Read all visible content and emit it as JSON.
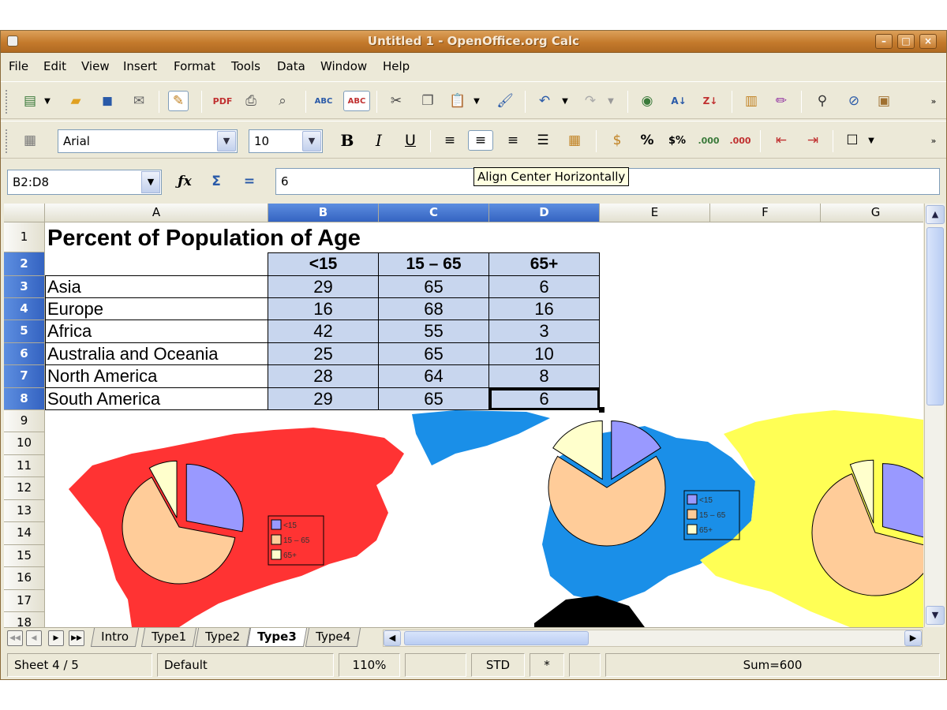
{
  "window": {
    "title": "Untitled 1 - OpenOffice.org Calc"
  },
  "menu": [
    "File",
    "Edit",
    "View",
    "Insert",
    "Format",
    "Tools",
    "Data",
    "Window",
    "Help"
  ],
  "formatting": {
    "font_name": "Arial",
    "font_size": "10"
  },
  "formula_bar": {
    "cell_reference": "B2:D8",
    "content": "6"
  },
  "tooltip": "Align Center Horizontally",
  "columns": [
    "A",
    "B",
    "C",
    "D",
    "E",
    "F",
    "G"
  ],
  "rows": [
    "1",
    "2",
    "3",
    "4",
    "5",
    "6",
    "7",
    "8",
    "9",
    "10",
    "11",
    "12",
    "13",
    "14",
    "15",
    "16",
    "17",
    "18"
  ],
  "sheet": {
    "title": "Percent of Population of Age",
    "headers": [
      "<15",
      "15 – 65",
      "65+"
    ],
    "data": [
      {
        "region": "Asia",
        "values": [
          "29",
          "65",
          "6"
        ]
      },
      {
        "region": "Europe",
        "values": [
          "16",
          "68",
          "16"
        ]
      },
      {
        "region": "Africa",
        "values": [
          "42",
          "55",
          "3"
        ]
      },
      {
        "region": "Australia and Oceania",
        "values": [
          "25",
          "65",
          "10"
        ]
      },
      {
        "region": "North America",
        "values": [
          "28",
          "64",
          "8"
        ]
      },
      {
        "region": "South America",
        "values": [
          "29",
          "65",
          "6"
        ]
      }
    ]
  },
  "charts": {
    "legend": [
      "<15",
      "15 – 65",
      "65+"
    ],
    "colors": {
      "under15": "#9999ff",
      "mid": "#ffcc99",
      "over65": "#ffffcc",
      "north_america": "#ff3333",
      "europe": "#1a8fe8",
      "asia": "#ffff55"
    },
    "pies": [
      {
        "values": [
          28,
          64,
          8
        ]
      },
      {
        "values": [
          16,
          68,
          16
        ]
      },
      {
        "values": [
          29,
          65,
          6
        ]
      }
    ]
  },
  "sheet_tabs": [
    "Intro",
    "Type1",
    "Type2",
    "Type3",
    "Type4"
  ],
  "active_tab": "Type3",
  "status": {
    "sheet": "Sheet 4 / 5",
    "page_style": "Default",
    "zoom": "110%",
    "mode": "STD",
    "modified": "*",
    "sum": "Sum=600"
  }
}
